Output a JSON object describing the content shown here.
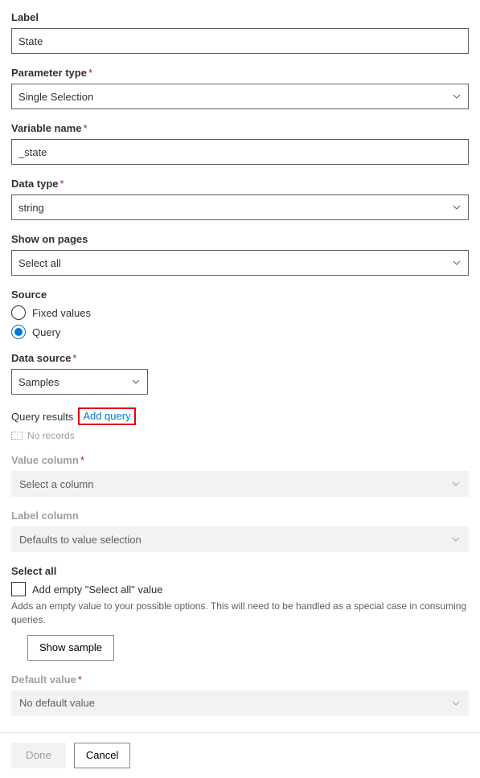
{
  "labels": {
    "label": "Label",
    "parameter_type": "Parameter type",
    "variable_name": "Variable name",
    "data_type": "Data type",
    "show_on_pages": "Show on pages",
    "source": "Source",
    "data_source": "Data source",
    "query_results": "Query results",
    "value_column": "Value column",
    "label_column": "Label column",
    "select_all": "Select all",
    "default_value": "Default value"
  },
  "values": {
    "label": "State",
    "parameter_type": "Single Selection",
    "variable_name": "_state",
    "data_type": "string",
    "show_on_pages": "Select all",
    "data_source": "Samples"
  },
  "source": {
    "fixed": "Fixed values",
    "query": "Query"
  },
  "actions": {
    "add_query": "Add query",
    "no_records": "No records",
    "show_sample": "Show sample",
    "done": "Done",
    "cancel": "Cancel"
  },
  "placeholders": {
    "value_column": "Select a column",
    "label_column": "Defaults to value selection",
    "default_value": "No default value"
  },
  "selectall": {
    "checkbox_label": "Add empty \"Select all\" value",
    "help": "Adds an empty value to your possible options. This will need to be handled as a special case in consuming queries."
  },
  "required_marker": "*"
}
